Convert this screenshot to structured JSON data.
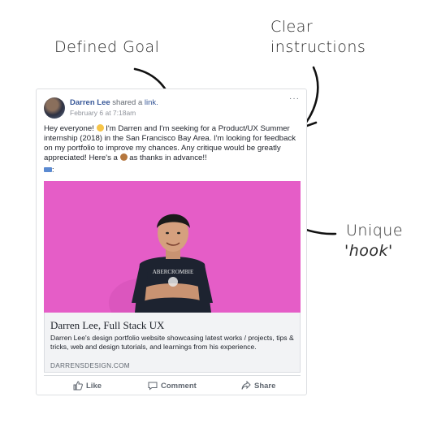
{
  "annotations": {
    "defined_goal": "Defined Goal",
    "clear_instructions_line1": "Clear",
    "clear_instructions_line2": "instructions",
    "unique_hook_line1": "Unique",
    "unique_hook_line2": "'hook'"
  },
  "post": {
    "author": "Darren Lee",
    "shared_text": "shared a",
    "shared_link": "link.",
    "timestamp": "February 6 at 7:18am",
    "more": "···",
    "body_part1": "Hey everyone! ",
    "body_part2": " I'm Darren and I'm seeking for a Product/UX Summer internship (2018) in the San Francisco Bay Area. I'm looking for feedback on my portfolio to improve my chances. Any critique would be greatly appreciated! Here's a ",
    "body_part3": " as thanks in advance!!",
    "laptop_suffix": ":"
  },
  "preview": {
    "title": "Darren Lee, Full Stack UX",
    "description": "Darren Lee's design portfolio website showcasing latest works / projects, tips & tricks, web and design tutorials, and learnings from his experience.",
    "domain": "DARRENSDESIGN.COM"
  },
  "actions": {
    "like": "Like",
    "comment": "Comment",
    "share": "Share"
  },
  "colors": {
    "link_blue": "#385898",
    "hero_pink": "#e55dc7",
    "text_dark": "#1d2129",
    "muted": "#606770"
  }
}
